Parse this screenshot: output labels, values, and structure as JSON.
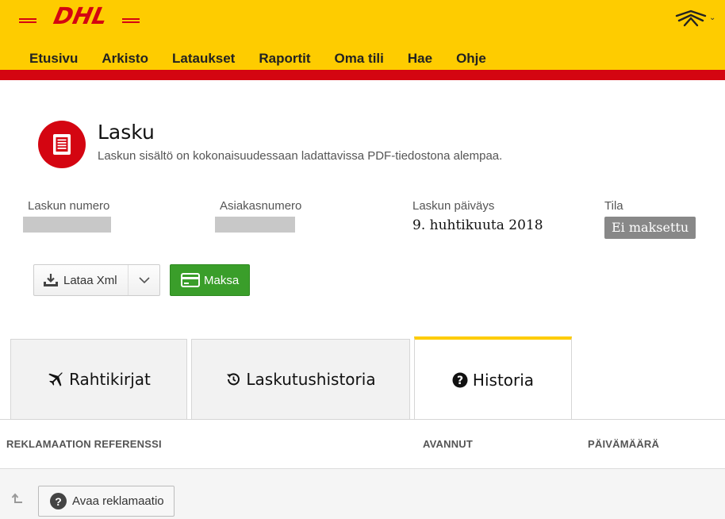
{
  "brand": {
    "logo_text": "DHL",
    "yellow": "#fecc00",
    "red": "#d40511"
  },
  "nav": {
    "items": [
      "Etusivu",
      "Arkisto",
      "Lataukset",
      "Raportit",
      "Oma tili",
      "Hae",
      "Ohje"
    ]
  },
  "user_menu": {
    "icon": "user-avatar-icon",
    "chevron": "⌄"
  },
  "page": {
    "icon": "document-icon",
    "title": "Lasku",
    "subtitle": "Laskun sisältö on kokonaisuudessaan ladattavissa PDF-tiedostona alempaa."
  },
  "fields": {
    "invoice_number_label": "Laskun numero",
    "customer_number_label": "Asiakasnumero",
    "invoice_date_label": "Laskun päiväys",
    "invoice_date_value": "9. huhtikuuta 2018",
    "status_label": "Tila",
    "status_value": "Ei maksettu",
    "status_color": "#888888"
  },
  "actions": {
    "download_label": "Lataa Xml",
    "pay_label": "Maksa",
    "pay_color": "#3a9e2a"
  },
  "tabs": [
    {
      "label": "Rahtikirjat",
      "icon": "plane-icon",
      "active": false
    },
    {
      "label": "Laskutushistoria",
      "icon": "history-icon",
      "active": false
    },
    {
      "label": "Historia",
      "icon": "question-icon",
      "active": true
    }
  ],
  "table": {
    "columns": [
      "REKLAMAATION REFERENSSI",
      "AVANNUT",
      "PÄIVÄMÄÄRÄ"
    ],
    "open_claim_label": "Avaa reklamaatio"
  }
}
